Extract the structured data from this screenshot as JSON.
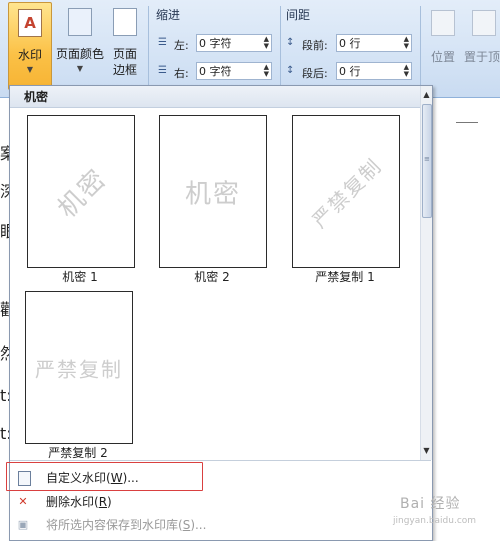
{
  "ribbon": {
    "watermark_button": "水印",
    "page_color_button": "页面颜色",
    "page_border_button": "页面边框",
    "indent": {
      "title": "缩进",
      "left_label": "左:",
      "left_value": "0 字符",
      "right_label": "右:",
      "right_value": "0 字符"
    },
    "spacing": {
      "title": "间距",
      "before_label": "段前:",
      "before_value": "0 行",
      "after_label": "段后:",
      "after_value": "0 行"
    },
    "position_button": "位置",
    "bring_front_button": "置于顶"
  },
  "document": {
    "chars": [
      "案",
      "深",
      "眼",
      "歡",
      "然",
      "t:",
      "t:"
    ]
  },
  "gallery": {
    "section_title": "机密",
    "items": [
      {
        "caption": "机密 1",
        "watermark": "机密"
      },
      {
        "caption": "机密 2",
        "watermark": "机密"
      },
      {
        "caption": "严禁复制 1",
        "watermark": "严禁复制"
      },
      {
        "caption": "严禁复制 2",
        "watermark": "严禁复制"
      }
    ]
  },
  "menu": {
    "custom_watermark": "自定义水印(",
    "custom_watermark_key": "W",
    "custom_watermark_suffix": ")...",
    "remove_watermark": "删除水印(",
    "remove_watermark_key": "R",
    "remove_watermark_suffix": ")",
    "save_selection": "将所选内容保存到水印库(",
    "save_selection_key": "S",
    "save_selection_suffix": ")..."
  },
  "overlay": {
    "site_watermark": "Bai 经验",
    "site_url": "jingyan.baidu.com"
  },
  "colors": {
    "selected_button": "#fbc146",
    "highlight_box": "#d94040",
    "ribbon_bg": "#d4e3f5"
  }
}
